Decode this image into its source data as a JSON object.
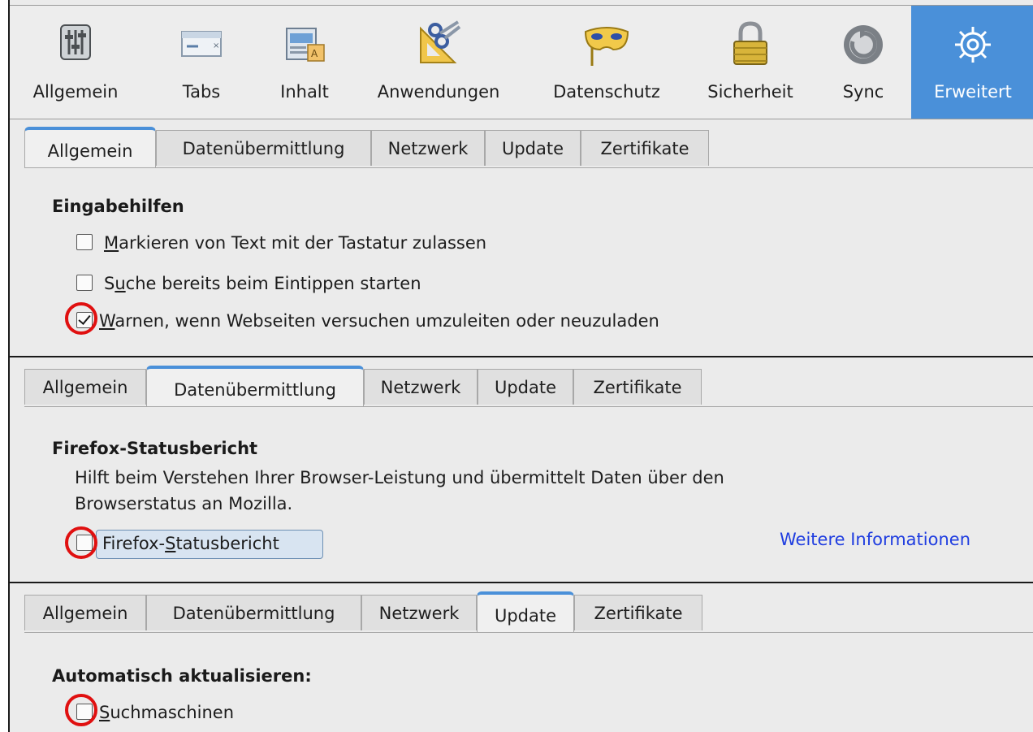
{
  "toolbar": {
    "items": [
      {
        "label": "Allgemein",
        "icon": "sliders-icon"
      },
      {
        "label": "Tabs",
        "icon": "tabs-icon"
      },
      {
        "label": "Inhalt",
        "icon": "content-icon"
      },
      {
        "label": "Anwendungen",
        "icon": "applications-icon"
      },
      {
        "label": "Datenschutz",
        "icon": "privacy-mask-icon"
      },
      {
        "label": "Sicherheit",
        "icon": "padlock-icon"
      },
      {
        "label": "Sync",
        "icon": "sync-icon"
      },
      {
        "label": "Erweitert",
        "icon": "gear-icon"
      }
    ],
    "active": "Erweitert"
  },
  "tabs": [
    "Allgemein",
    "Datenübermittlung",
    "Netzwerk",
    "Update",
    "Zertifikate"
  ],
  "section1": {
    "active_tab": "Allgemein",
    "heading": "Eingabehilfen",
    "options": [
      {
        "pre": "",
        "key": "M",
        "post": "arkieren von Text mit der Tastatur zulassen",
        "checked": false
      },
      {
        "pre": "S",
        "key": "u",
        "post": "che bereits beim Eintippen starten",
        "checked": false
      },
      {
        "pre": "",
        "key": "W",
        "post": "arnen, wenn Webseiten versuchen umzuleiten oder neuzuladen",
        "checked": true
      }
    ]
  },
  "section2": {
    "active_tab": "Datenübermittlung",
    "heading": "Firefox-Statusbericht",
    "description_line1": "Hilft beim Verstehen Ihrer Browser-Leistung und übermittelt Daten über den",
    "description_line2": "Browserstatus an Mozilla.",
    "option": {
      "pre": "Firefox-",
      "key": "S",
      "post": "tatusbericht",
      "checked": false
    },
    "link": "Weitere Informationen"
  },
  "section3": {
    "active_tab": "Update",
    "heading": "Automatisch aktualisieren:",
    "option": {
      "pre": "",
      "key": "S",
      "post": "uchmaschinen",
      "checked": false
    }
  },
  "colors": {
    "accent": "#4a90d9",
    "highlight_ring": "#e01010",
    "link": "#1f3de0"
  }
}
